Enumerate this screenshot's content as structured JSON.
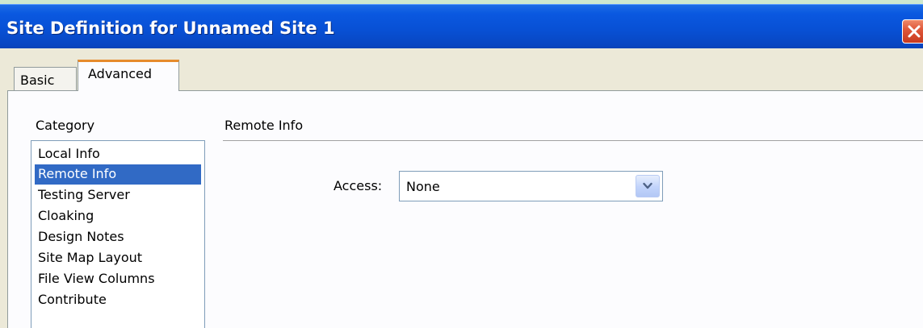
{
  "window": {
    "title": "Site Definition for Unnamed Site 1"
  },
  "tabs": [
    {
      "label": "Basic"
    },
    {
      "label": "Advanced"
    }
  ],
  "category": {
    "label": "Category",
    "items": [
      {
        "label": "Local Info"
      },
      {
        "label": "Remote Info"
      },
      {
        "label": "Testing Server"
      },
      {
        "label": "Cloaking"
      },
      {
        "label": "Design Notes"
      },
      {
        "label": "Site Map Layout"
      },
      {
        "label": "File View Columns"
      },
      {
        "label": "Contribute"
      }
    ],
    "selected": "Remote Info"
  },
  "section": {
    "title": "Remote Info"
  },
  "access": {
    "label": "Access:",
    "value": "None"
  },
  "icons": {
    "close": "close-icon",
    "dropdown": "chevron-down-icon"
  },
  "colors": {
    "titlebar": "#0a58e0",
    "selection": "#316ac5",
    "active_tab_accent": "#e68b2c",
    "close_button": "#e0583a"
  }
}
